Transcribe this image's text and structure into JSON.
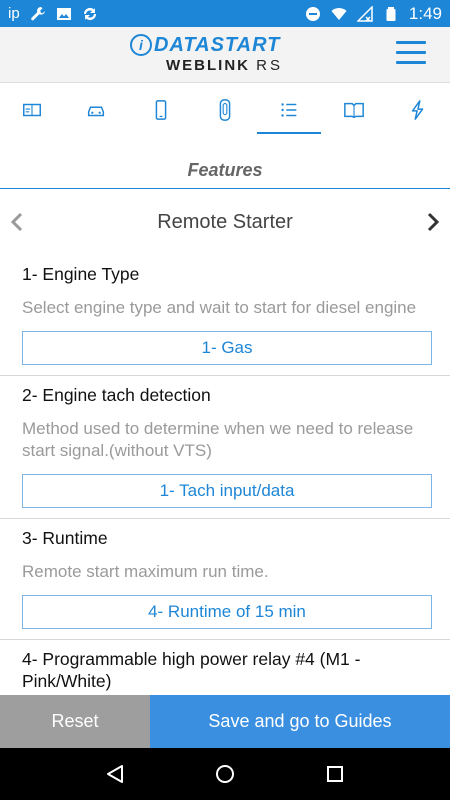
{
  "status_bar": {
    "carrier": "ip",
    "time": "1:49",
    "icons": [
      "wrench-icon",
      "image-icon",
      "sync-icon",
      "do-not-disturb-icon",
      "wifi-icon",
      "signal-off-icon",
      "battery-icon"
    ]
  },
  "header": {
    "logo_brand": "DATASTART",
    "logo_line2": "WEBLINK",
    "logo_line2_suffix": "RS",
    "menu_icon": "hamburger-icon"
  },
  "tabs": [
    {
      "icon": "id-card-icon",
      "active": false
    },
    {
      "icon": "car-icon",
      "active": false
    },
    {
      "icon": "phone-icon",
      "active": false
    },
    {
      "icon": "remote-icon",
      "active": false
    },
    {
      "icon": "list-icon",
      "active": true
    },
    {
      "icon": "book-icon",
      "active": false
    },
    {
      "icon": "lightning-icon",
      "active": false
    }
  ],
  "section_title": "Features",
  "category": {
    "title": "Remote Starter",
    "prev_icon": "chevron-left-icon",
    "next_icon": "chevron-right-icon"
  },
  "features": [
    {
      "title": "1- Engine Type",
      "description": "Select engine type and wait to start for diesel engine",
      "value": "1- Gas"
    },
    {
      "title": "2- Engine tach detection",
      "description": "Method used to determine when we need to release start signal.(without VTS)",
      "value": "1- Tach input/data"
    },
    {
      "title": "3- Runtime",
      "description": "Remote start maximum run time.",
      "value": "4- Runtime of 15 min"
    },
    {
      "title": "4- Programmable high power relay #4 (M1 - Pink/White)",
      "description": "",
      "value": ""
    }
  ],
  "buttons": {
    "reset": "Reset",
    "save": "Save and go to Guides"
  },
  "colors": {
    "accent": "#1e86d6",
    "save_button": "#3a8fe0",
    "reset_button": "#9e9e9e"
  }
}
